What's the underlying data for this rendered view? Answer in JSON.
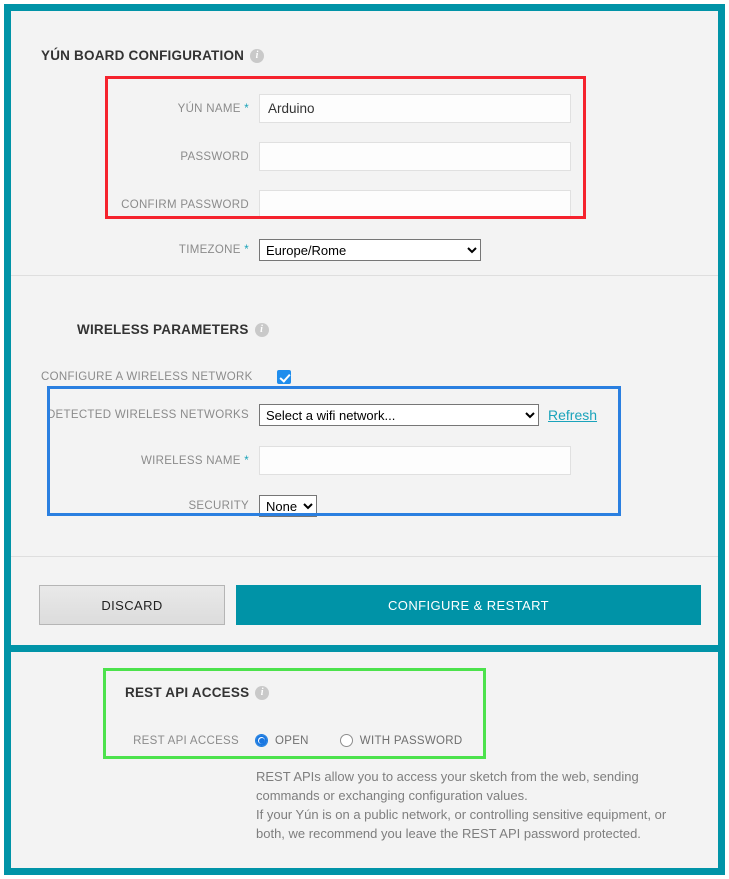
{
  "theme": {
    "teal": "#0093a7",
    "panel_bg": "#f3f3f3",
    "link": "#1aa3bb",
    "annot_red": "#f5222d",
    "annot_blue": "#2a7fe0",
    "annot_green": "#4ce24c"
  },
  "board_section": {
    "title": "YÚN BOARD CONFIGURATION",
    "info_glyph": "i",
    "fields": {
      "yun_name": {
        "label": "YÚN NAME",
        "required_mark": "*",
        "value": "Arduino",
        "placeholder": ""
      },
      "password": {
        "label": "PASSWORD",
        "required_mark": "",
        "value": "",
        "placeholder": ""
      },
      "confirm_password": {
        "label": "CONFIRM PASSWORD",
        "required_mark": "",
        "value": "",
        "placeholder": ""
      },
      "timezone": {
        "label": "TIMEZONE",
        "required_mark": "*",
        "value": "Europe/Rome",
        "options": [
          "Europe/Rome"
        ]
      }
    }
  },
  "wireless_section": {
    "title": "WIRELESS PARAMETERS",
    "info_glyph": "i",
    "configure_checkbox": {
      "label": "CONFIGURE A WIRELESS NETWORK",
      "checked": true
    },
    "fields": {
      "detected_networks": {
        "label": "DETECTED WIRELESS NETWORKS",
        "value": "Select a wifi network...",
        "options": [
          "Select a wifi network..."
        ]
      },
      "refresh_link": "Refresh",
      "wireless_name": {
        "label": "WIRELESS NAME",
        "required_mark": "*",
        "value": "",
        "placeholder": ""
      },
      "security": {
        "label": "SECURITY",
        "value": "None",
        "options": [
          "None"
        ]
      }
    }
  },
  "actions": {
    "discard_label": "DISCARD",
    "configure_label": "CONFIGURE & RESTART"
  },
  "rest_section": {
    "title": "REST API ACCESS",
    "info_glyph": "i",
    "field_label": "REST API ACCESS",
    "options": [
      {
        "label": "OPEN",
        "selected": true
      },
      {
        "label": "WITH PASSWORD",
        "selected": false
      }
    ],
    "description_lines": [
      "REST APIs allow you to access your sketch from the web, sending",
      "commands or exchanging configuration values.",
      "If your Yún is on a public network, or controlling sensitive equipment, or",
      "both, we recommend you leave the REST API password protected."
    ]
  }
}
